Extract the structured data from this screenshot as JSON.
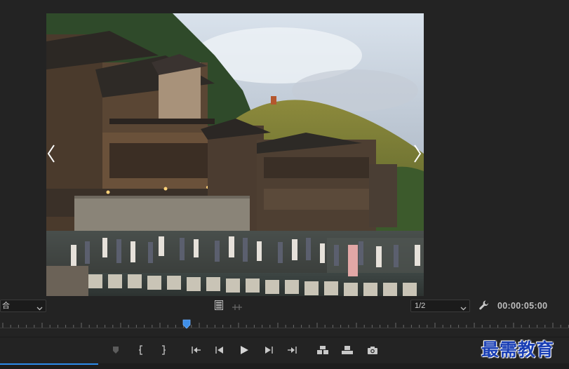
{
  "viewer": {
    "fit_value": "合",
    "resolution_value": "1/2",
    "timecode": "00:00:05:00",
    "playhead_fraction": 0.33
  },
  "transport": {
    "buttons": [
      {
        "name": "add-marker-button",
        "icon": "marker-icon"
      },
      {
        "name": "mark-in-button",
        "icon": "mark-in-icon"
      },
      {
        "name": "mark-out-button",
        "icon": "mark-out-icon"
      },
      {
        "name": "go-to-in-button",
        "icon": "go-to-in-icon"
      },
      {
        "name": "step-back-button",
        "icon": "step-back-icon"
      },
      {
        "name": "play-button",
        "icon": "play-icon"
      },
      {
        "name": "step-forward-button",
        "icon": "step-forward-icon"
      },
      {
        "name": "go-to-out-button",
        "icon": "go-to-out-icon"
      },
      {
        "name": "insert-button",
        "icon": "insert-icon"
      },
      {
        "name": "overwrite-button",
        "icon": "overwrite-icon"
      },
      {
        "name": "export-frame-button",
        "icon": "camera-icon"
      }
    ]
  },
  "colors": {
    "panel_bg": "#232323",
    "accent": "#2d8ceb",
    "playhead": "#3f8fe8"
  },
  "watermark": {
    "text": "最需教育"
  }
}
